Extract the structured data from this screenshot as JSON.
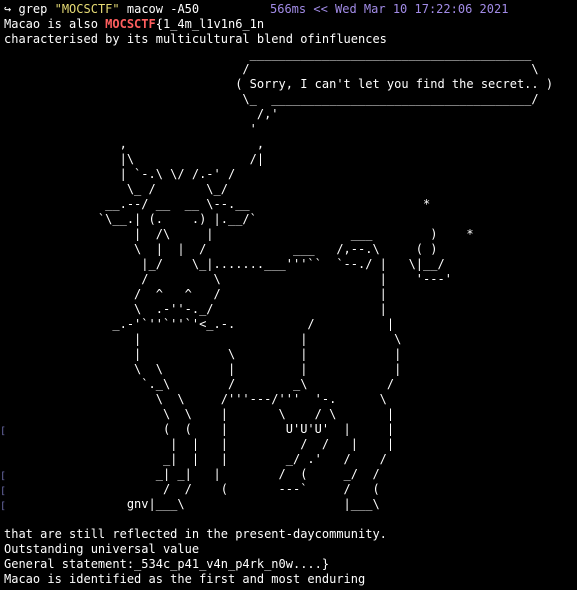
{
  "prompt": {
    "arrow": "↪",
    "command": "grep",
    "pattern": "\"MOCSCTF\"",
    "file": "macow",
    "option": "-A50",
    "timing": "566ms << Wed Mar 10 17:22:06 2021"
  },
  "output": {
    "line1_pre": "Macao is also ",
    "line1_match": "MOCSCTF",
    "line1_post": "{1_4m_l1v1n6_1n",
    "line2": "characterised by its multicultural blend ofinfluences",
    "cowsay": "                                  _______________________________________\n                                 /                                       \\\n                                ( Sorry, I can't let you find the secret.. )\n                                 \\_  ____________________________________/\n                                   /,'\n                                  '\n                ,                  ,\n                |\\                /|\n                | `-.\\ \\/ /.-' /\n                 \\_ /       \\_/\n              __.--/ __  __ \\--.__                        *\n             `\\__.| (.    .) |.__/`\n                  |  /\\     |                   ___        )    *\n                  \\  |  |  /            ___   /,--.\\     ( )\n                   |_/    \\_|.......___'''``  `--./ |   \\|__/\n                   /         \\                      |    '---'\n                  /  ^   ^   /                      |\n                  \\  .-''-._/                       |\n               _.-'`''`''`'<_.-.          /          |\n                  |                      |            \\\n                  |            \\         |            |\n                  \\  \\         |         |            |\n                   `._\\        /        _\\           /\n                     \\  \\     /'''---/'''  '-.      \\\n                      \\  \\    |       \\    / \\       |\n                      (  (    |        U'U'U'  |     |\n                       |  |   |          /  /   |    |\n                      _|  |   |        _/ .'   /    /\n                     _| _|   |        /  (     _/  /\n                      /  /    (       ---`     /   (\n                 gnv|___\\                      |___\\",
    "line3": "that are still reflected in the present-daycommunity.",
    "line4": "Outstanding universal value",
    "line5": "General statement:_534c_p41_v4n_p4rk_n0w....}",
    "line6": "Macao is identified as the first and most enduring"
  },
  "gutter_marks": [
    "[",
    "[",
    "[",
    "["
  ],
  "colors": {
    "background": "#000000",
    "text": "#ffffff",
    "string": "#e6db74",
    "timing": "#a18be6",
    "match": "#ff5f5f"
  }
}
